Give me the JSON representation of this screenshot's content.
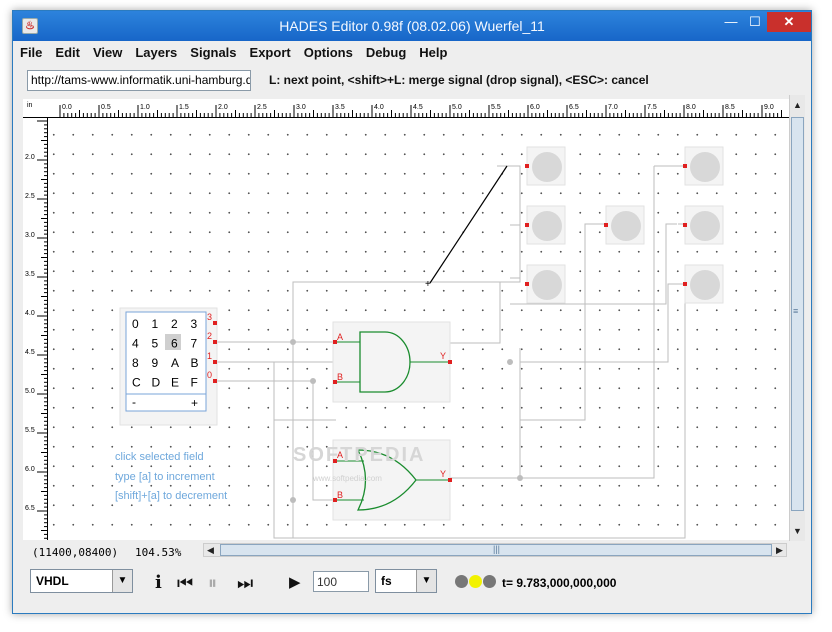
{
  "window": {
    "icon_glyph": "♨",
    "title": "HADES Editor 0.98f (08.02.06)   Wuerfel_11",
    "minimize_glyph": "—",
    "maximize_glyph": "☐",
    "close_glyph": "✕"
  },
  "menu": [
    "File",
    "Edit",
    "View",
    "Layers",
    "Signals",
    "Export",
    "Options",
    "Debug",
    "Help"
  ],
  "toolbar": {
    "url": "http://tams-www.informatik.uni-hamburg.de",
    "hint": "L: next point, <shift>+L: merge signal (drop signal), <ESC>: cancel"
  },
  "ruler": {
    "top_unit": "in",
    "top_labels": [
      "0.0",
      "0.5",
      "1.0",
      "1.5",
      "2.0",
      "2.5",
      "3.0",
      "3.5",
      "4.0",
      "4.5",
      "5.0",
      "5.5",
      "6.0",
      "6.5",
      "7.0",
      "7.5",
      "8.0",
      "8.5",
      "9.0"
    ],
    "left_labels": [
      "2.0",
      "2.5",
      "3.0",
      "3.5",
      "4.0",
      "4.5",
      "5.0",
      "5.5",
      "6.0",
      "6.5"
    ]
  },
  "circuit": {
    "hex_keypad": {
      "keys": [
        "0",
        "1",
        "2",
        "3",
        "4",
        "5",
        "6",
        "7",
        "8",
        "9",
        "A",
        "B",
        "C",
        "D",
        "E",
        "F"
      ],
      "selected_key": "6",
      "minus": "-",
      "plus": "+",
      "pin_labels": [
        "3",
        "2",
        "1",
        "0"
      ]
    },
    "and_gate": {
      "input_a": "A",
      "input_b": "B",
      "output": "Y"
    },
    "or_gate": {
      "input_a": "A",
      "input_b": "B",
      "output": "Y"
    },
    "instructions": [
      "click selected field",
      "type [a]  to increment",
      "[shift]+[a]  to decrement"
    ],
    "watermark": "SOFTPEDIA",
    "watermark_sub": "www.softpedia.com"
  },
  "status": {
    "coords": "(11400,08400)",
    "zoom": "104.53%"
  },
  "bottom": {
    "language": "VHDL",
    "info_glyph": "i",
    "rewind_glyph": "⏮",
    "pause_glyph": "⏸",
    "fastforward_glyph": "⏭",
    "play_glyph": "▶",
    "time_value": "100",
    "time_unit": "fs",
    "dropdown_glyph": "▼",
    "sim_time": "t= 9.783,000,000,000",
    "led_colors": [
      "#777777",
      "#f2f200",
      "#777777"
    ]
  },
  "scroll": {
    "up": "▲",
    "down": "▼",
    "left": "◀",
    "right": "▶",
    "grip_v": "≡",
    "grip_h": "|||"
  }
}
